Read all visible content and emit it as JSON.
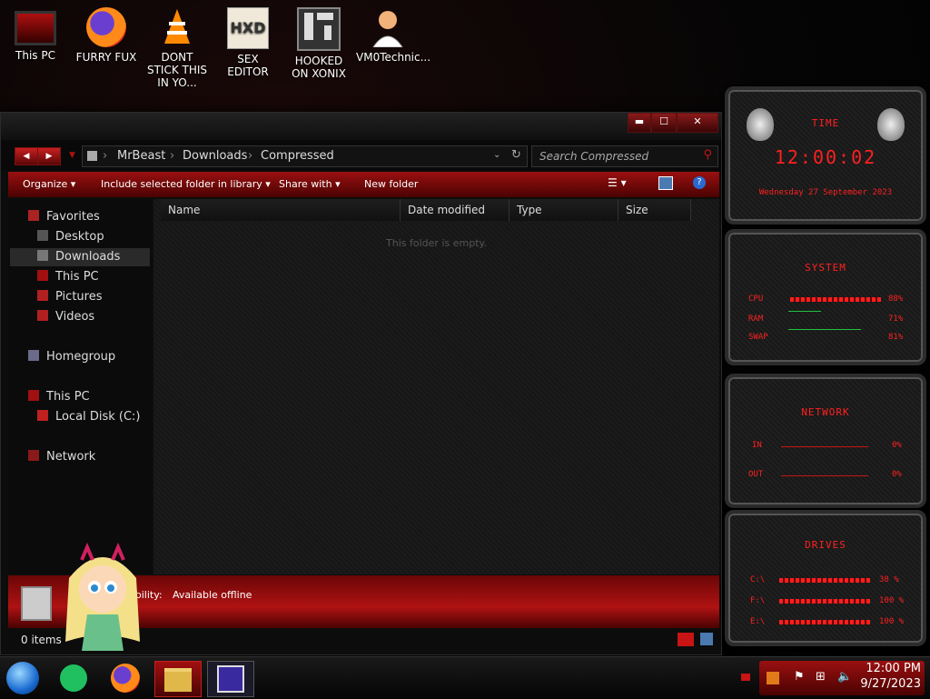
{
  "desktop_icons": [
    {
      "label": "This PC"
    },
    {
      "label": "FURRY FUX"
    },
    {
      "label": "DONT STICK THIS IN YO..."
    },
    {
      "label": "SEX EDITOR"
    },
    {
      "label": "HOOKED ON XONIX"
    },
    {
      "label": "VM0Technic..."
    }
  ],
  "explorer": {
    "breadcrumb": [
      "MrBeast",
      "Downloads",
      "Compressed"
    ],
    "search_placeholder": "Search Compressed",
    "commands": {
      "organize": "Organize",
      "include": "Include selected folder in library",
      "share": "Share with",
      "new_folder": "New folder"
    },
    "columns": [
      "Name",
      "Date modified",
      "Type",
      "Size"
    ],
    "empty_text": "This folder is empty.",
    "nav": {
      "favorites": "Favorites",
      "desktop": "Desktop",
      "downloads": "Downloads",
      "thispc_fav": "This PC",
      "pictures": "Pictures",
      "videos": "Videos",
      "homegroup": "Homegroup",
      "thispc": "This PC",
      "local_disk": "Local Disk (C:)",
      "network": "Network"
    },
    "details": {
      "label": "ability:",
      "value": "Available offline"
    },
    "status": "0 items"
  },
  "widgets": {
    "time": {
      "title": "TIME",
      "clock": "12:00:02",
      "date": "Wednesday 27 September 2023"
    },
    "system": {
      "title": "SYSTEM",
      "rows": [
        {
          "label": "CPU",
          "value": "88%"
        },
        {
          "label": "RAM",
          "value": "71%"
        },
        {
          "label": "SWAP",
          "value": "81%"
        }
      ]
    },
    "network": {
      "title": "NETWORK",
      "rows": [
        {
          "label": "IN",
          "value": "0%"
        },
        {
          "label": "OUT",
          "value": "0%"
        }
      ]
    },
    "drives": {
      "title": "DRIVES",
      "rows": [
        {
          "label": "C:\\",
          "value": "38 %"
        },
        {
          "label": "F:\\",
          "value": "100 %"
        },
        {
          "label": "E:\\",
          "value": "100 %"
        }
      ]
    }
  },
  "taskbar": {
    "time": "12:00 PM",
    "date": "9/27/2023"
  },
  "colors": {
    "accent": "#c81414",
    "dark": "#0d0d0d"
  }
}
